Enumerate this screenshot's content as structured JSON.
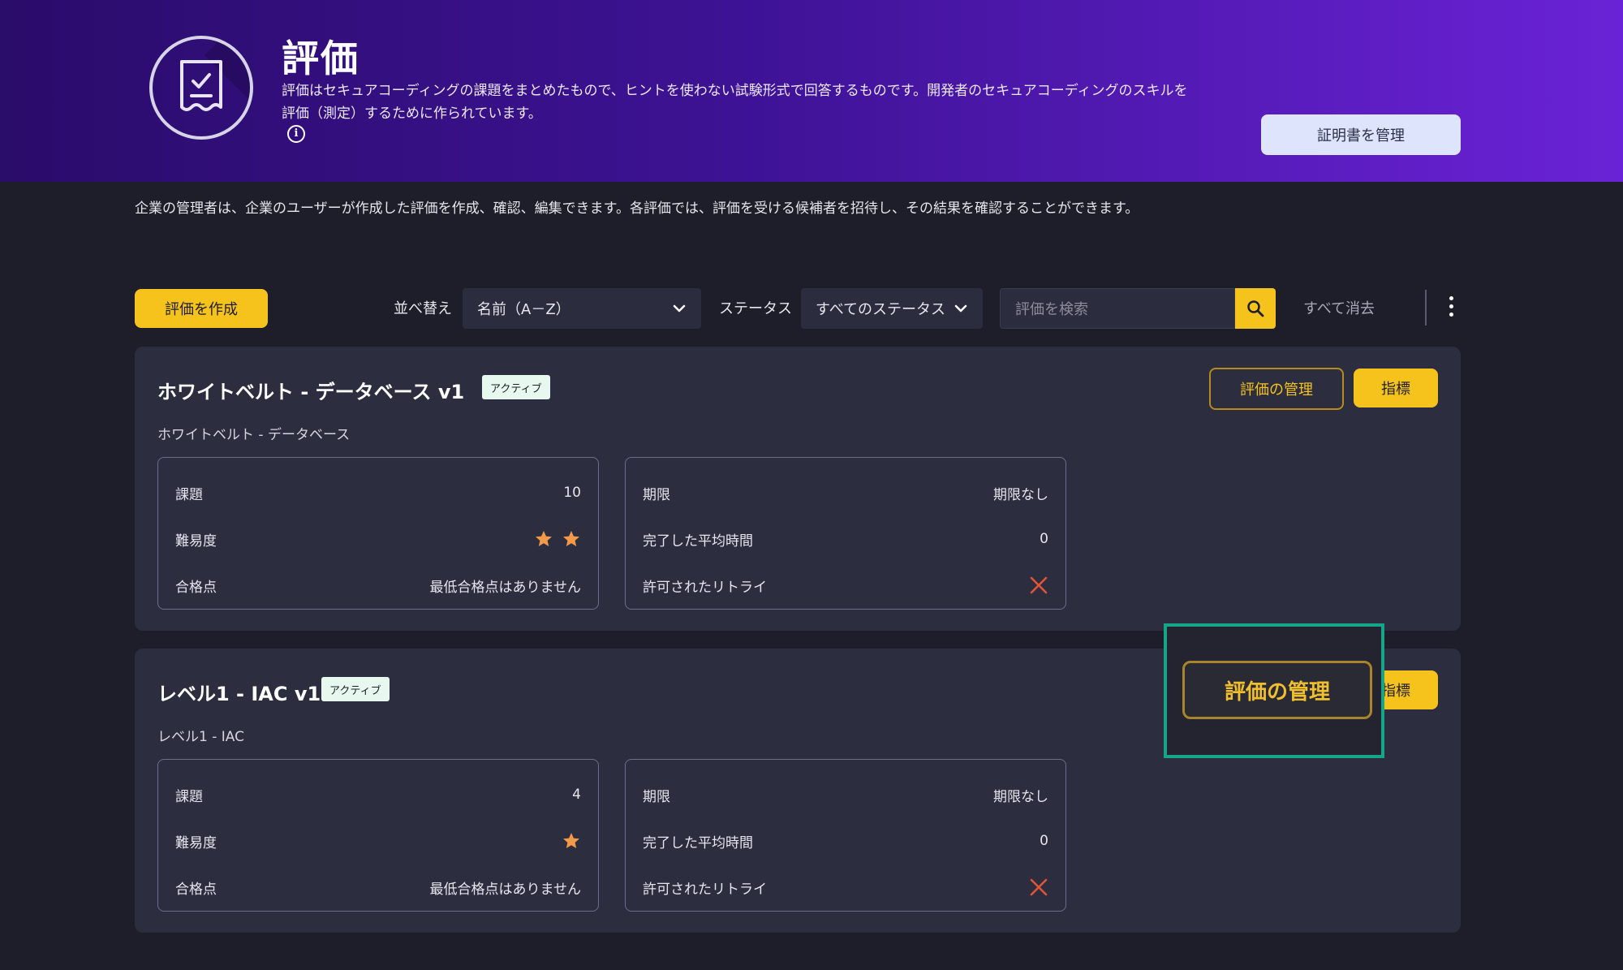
{
  "header": {
    "title": "評価",
    "description": "評価はセキュアコーディングの課題をまとめたもので、ヒントを使わない試験形式で回答するものです。開発者のセキュアコーディングのスキルを評価（測定）するために作られています。",
    "info_icon": "i",
    "manage_certificates_label": "証明書を管理",
    "icon": "clipboard-check-icon"
  },
  "sub_description": "企業の管理者は、企業のユーザーが作成した評価を作成、確認、編集できます。各評価では、評価を受ける候補者を招待し、その結果を確認することができます。",
  "toolbar": {
    "create_label": "評価を作成",
    "sort_label": "並べ替え",
    "sort_value": "名前（A－Z）",
    "status_label": "ステータス",
    "status_value": "すべてのステータス",
    "search_placeholder": "評価を検索",
    "clear_all_label": "すべて消去"
  },
  "colors": {
    "accent": "#f6c31c",
    "background": "#1e1e2a",
    "card": "#2c2d3e",
    "highlight": "#17a58a",
    "star": "#f2994a",
    "cross": "#e0553a"
  },
  "assessments": [
    {
      "title": "ホワイトベルト - データベース v1",
      "status": "アクティブ",
      "subtitle": "ホワイトベルト - データベース",
      "manage_label": "評価の管理",
      "metrics_label": "指標",
      "left_panel": [
        {
          "label": "課題",
          "value": "10"
        },
        {
          "label": "難易度",
          "stars": 2
        },
        {
          "label": "合格点",
          "value": "最低合格点はありません"
        }
      ],
      "right_panel": [
        {
          "label": "期限",
          "value": "期限なし"
        },
        {
          "label": "完了した平均時間",
          "value": "0"
        },
        {
          "label": "許可されたリトライ",
          "retries_allowed": false
        }
      ]
    },
    {
      "title": "レベル1 - IAC v1",
      "status": "アクティブ",
      "subtitle": "レベル1 - IAC",
      "manage_label": "評価の管理",
      "metrics_label": "指標",
      "left_panel": [
        {
          "label": "課題",
          "value": "4"
        },
        {
          "label": "難易度",
          "stars": 1
        },
        {
          "label": "合格点",
          "value": "最低合格点はありません"
        }
      ],
      "right_panel": [
        {
          "label": "期限",
          "value": "期限なし"
        },
        {
          "label": "完了した平均時間",
          "value": "0"
        },
        {
          "label": "許可されたリトライ",
          "retries_allowed": false
        }
      ]
    }
  ],
  "zoom_callout": {
    "label": "評価の管理"
  }
}
